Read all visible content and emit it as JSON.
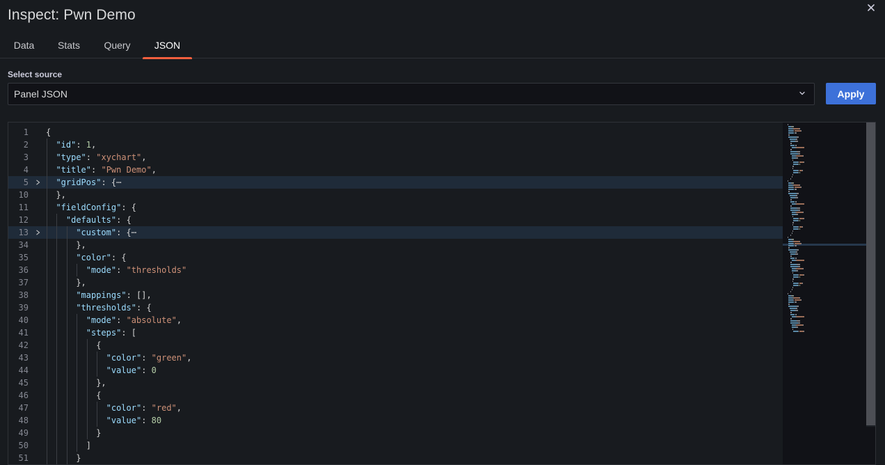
{
  "title": "Inspect: Pwn Demo",
  "tabs": [
    {
      "label": "Data",
      "active": false
    },
    {
      "label": "Stats",
      "active": false
    },
    {
      "label": "Query",
      "active": false
    },
    {
      "label": "JSON",
      "active": true
    }
  ],
  "source": {
    "label": "Select source",
    "selected": "Panel JSON"
  },
  "apply_label": "Apply",
  "colors": {
    "accent": "#3d71d9",
    "tab_indicator": "#f55f3e",
    "json_key": "#9cdcfe",
    "json_string": "#ce9178",
    "json_number": "#b5cea8"
  },
  "editor": {
    "lines": [
      {
        "num": "1",
        "indent": 0,
        "tokens": [
          [
            "p",
            "{"
          ]
        ]
      },
      {
        "num": "2",
        "indent": 1,
        "tokens": [
          [
            "k",
            "\"id\""
          ],
          [
            "p",
            ": "
          ],
          [
            "n",
            "1"
          ],
          [
            "p",
            ","
          ]
        ]
      },
      {
        "num": "3",
        "indent": 1,
        "tokens": [
          [
            "k",
            "\"type\""
          ],
          [
            "p",
            ": "
          ],
          [
            "s",
            "\"xychart\""
          ],
          [
            "p",
            ","
          ]
        ]
      },
      {
        "num": "4",
        "indent": 1,
        "tokens": [
          [
            "k",
            "\"title\""
          ],
          [
            "p",
            ": "
          ],
          [
            "s",
            "\"Pwn Demo\""
          ],
          [
            "p",
            ","
          ]
        ]
      },
      {
        "num": "5",
        "indent": 1,
        "folded": true,
        "hl": true,
        "tokens": [
          [
            "k",
            "\"gridPos\""
          ],
          [
            "p",
            ": {"
          ],
          [
            "p",
            "⋯"
          ]
        ]
      },
      {
        "num": "10",
        "indent": 1,
        "tokens": [
          [
            "p",
            "},"
          ]
        ]
      },
      {
        "num": "11",
        "indent": 1,
        "tokens": [
          [
            "k",
            "\"fieldConfig\""
          ],
          [
            "p",
            ": {"
          ]
        ]
      },
      {
        "num": "12",
        "indent": 2,
        "tokens": [
          [
            "k",
            "\"defaults\""
          ],
          [
            "p",
            ": {"
          ]
        ]
      },
      {
        "num": "13",
        "indent": 3,
        "folded": true,
        "hl": true,
        "tokens": [
          [
            "k",
            "\"custom\""
          ],
          [
            "p",
            ": {"
          ],
          [
            "p",
            "⋯"
          ]
        ]
      },
      {
        "num": "34",
        "indent": 3,
        "tokens": [
          [
            "p",
            "},"
          ]
        ]
      },
      {
        "num": "35",
        "indent": 3,
        "tokens": [
          [
            "k",
            "\"color\""
          ],
          [
            "p",
            ": {"
          ]
        ]
      },
      {
        "num": "36",
        "indent": 4,
        "tokens": [
          [
            "k",
            "\"mode\""
          ],
          [
            "p",
            ": "
          ],
          [
            "s",
            "\"thresholds\""
          ]
        ]
      },
      {
        "num": "37",
        "indent": 3,
        "tokens": [
          [
            "p",
            "},"
          ]
        ]
      },
      {
        "num": "38",
        "indent": 3,
        "tokens": [
          [
            "k",
            "\"mappings\""
          ],
          [
            "p",
            ": [],"
          ]
        ]
      },
      {
        "num": "39",
        "indent": 3,
        "tokens": [
          [
            "k",
            "\"thresholds\""
          ],
          [
            "p",
            ": {"
          ]
        ]
      },
      {
        "num": "40",
        "indent": 4,
        "tokens": [
          [
            "k",
            "\"mode\""
          ],
          [
            "p",
            ": "
          ],
          [
            "s",
            "\"absolute\""
          ],
          [
            "p",
            ","
          ]
        ]
      },
      {
        "num": "41",
        "indent": 4,
        "tokens": [
          [
            "k",
            "\"steps\""
          ],
          [
            "p",
            ": ["
          ]
        ]
      },
      {
        "num": "42",
        "indent": 5,
        "tokens": [
          [
            "p",
            "{"
          ]
        ]
      },
      {
        "num": "43",
        "indent": 6,
        "tokens": [
          [
            "k",
            "\"color\""
          ],
          [
            "p",
            ": "
          ],
          [
            "s",
            "\"green\""
          ],
          [
            "p",
            ","
          ]
        ]
      },
      {
        "num": "44",
        "indent": 6,
        "tokens": [
          [
            "k",
            "\"value\""
          ],
          [
            "p",
            ": "
          ],
          [
            "n",
            "0"
          ]
        ]
      },
      {
        "num": "45",
        "indent": 5,
        "tokens": [
          [
            "p",
            "},"
          ]
        ]
      },
      {
        "num": "46",
        "indent": 5,
        "tokens": [
          [
            "p",
            "{"
          ]
        ]
      },
      {
        "num": "47",
        "indent": 6,
        "tokens": [
          [
            "k",
            "\"color\""
          ],
          [
            "p",
            ": "
          ],
          [
            "s",
            "\"red\""
          ],
          [
            "p",
            ","
          ]
        ]
      },
      {
        "num": "48",
        "indent": 6,
        "tokens": [
          [
            "k",
            "\"value\""
          ],
          [
            "p",
            ": "
          ],
          [
            "n",
            "80"
          ]
        ]
      },
      {
        "num": "49",
        "indent": 5,
        "tokens": [
          [
            "p",
            "}"
          ]
        ]
      },
      {
        "num": "50",
        "indent": 4,
        "tokens": [
          [
            "p",
            "]"
          ]
        ]
      },
      {
        "num": "51",
        "indent": 3,
        "tokens": [
          [
            "p",
            "}"
          ]
        ]
      }
    ]
  }
}
